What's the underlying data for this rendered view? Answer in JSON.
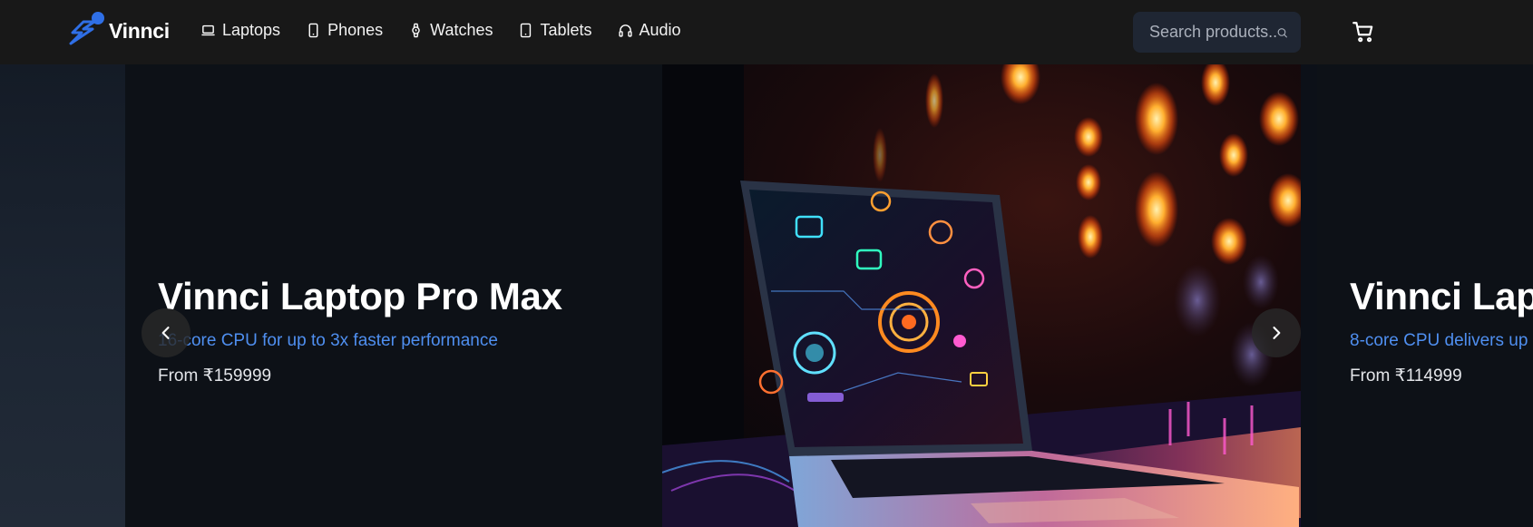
{
  "brand": {
    "name": "Vinnci",
    "accent": "#2f6fe6"
  },
  "nav": {
    "items": [
      {
        "label": "Laptops",
        "icon": "laptop-icon"
      },
      {
        "label": "Phones",
        "icon": "phone-icon"
      },
      {
        "label": "Watches",
        "icon": "watch-icon"
      },
      {
        "label": "Tablets",
        "icon": "tablet-icon"
      },
      {
        "label": "Audio",
        "icon": "headphones-icon"
      }
    ]
  },
  "search": {
    "placeholder": "Search products...",
    "icon": "search-icon"
  },
  "cart": {
    "icon": "cart-icon"
  },
  "carousel": {
    "slides": [
      {
        "title": "Vinnci Laptop Pro Max",
        "subtitle": "16-core CPU for up to 3x faster performance",
        "price": "From ₹159999"
      },
      {
        "title": "Vinnci Laptop",
        "subtitle": "8-core CPU delivers up",
        "price": "From ₹114999"
      }
    ],
    "prev_icon": "chevron-left-icon",
    "next_icon": "chevron-right-icon"
  },
  "colors": {
    "navbar_bg": "#181818",
    "slide_bg": "#0d1117",
    "subtitle": "#4f8ff0",
    "search_bg": "#1f2633"
  }
}
